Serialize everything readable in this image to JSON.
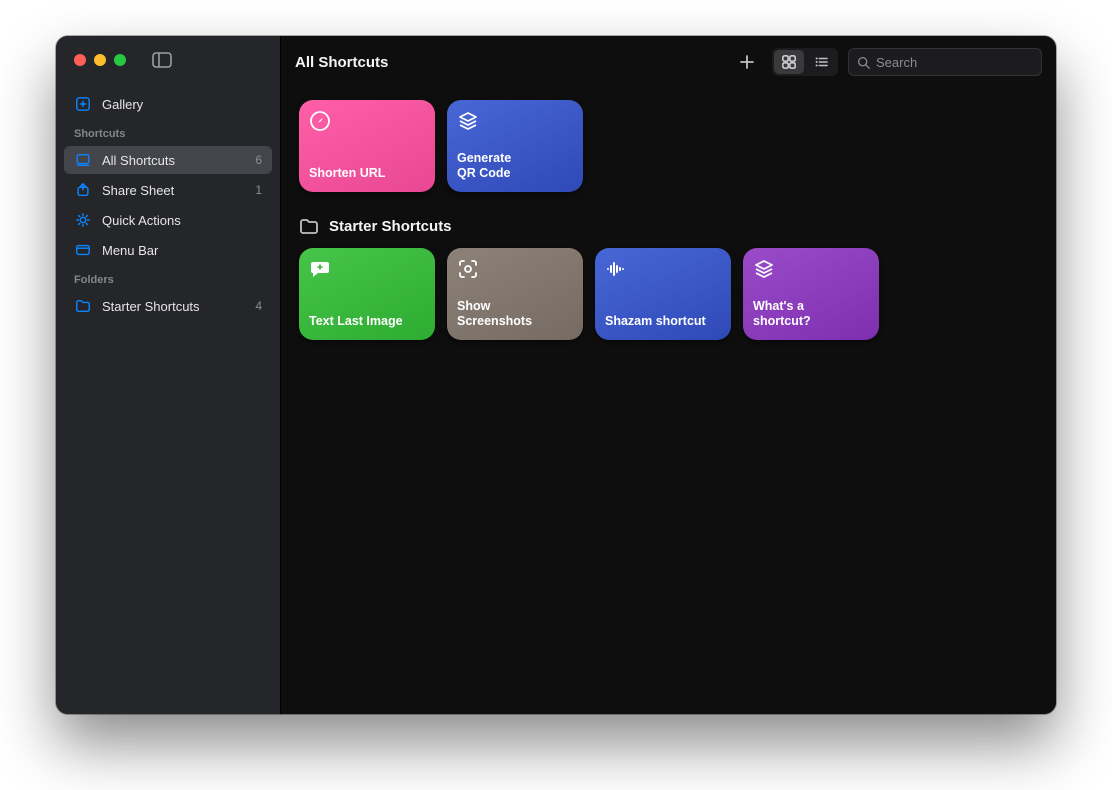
{
  "header": {
    "title": "All Shortcuts",
    "search_placeholder": "Search"
  },
  "sidebar": {
    "gallery_label": "Gallery",
    "section_shortcuts": "Shortcuts",
    "section_folders": "Folders",
    "items": [
      {
        "label": "All Shortcuts",
        "count": "6",
        "icon": "layers",
        "selected": true
      },
      {
        "label": "Share Sheet",
        "count": "1",
        "icon": "share",
        "selected": false
      },
      {
        "label": "Quick Actions",
        "count": "",
        "icon": "gear",
        "selected": false
      },
      {
        "label": "Menu Bar",
        "count": "",
        "icon": "menubar",
        "selected": false
      }
    ],
    "folders": [
      {
        "label": "Starter Shortcuts",
        "count": "4",
        "icon": "folder"
      }
    ]
  },
  "main": {
    "top_row": [
      {
        "label": "Shorten URL",
        "icon": "safari",
        "gradient": "g-pink"
      },
      {
        "label": "Generate\nQR Code",
        "icon": "layers",
        "gradient": "g-blue"
      }
    ],
    "section_title": "Starter Shortcuts",
    "starter_row": [
      {
        "label": "Text Last Image",
        "icon": "message-plus",
        "gradient": "g-green"
      },
      {
        "label": "Show\nScreenshots",
        "icon": "viewfinder",
        "gradient": "g-gray"
      },
      {
        "label": "Shazam shortcut",
        "icon": "waveform",
        "gradient": "g-blue2"
      },
      {
        "label": "What's a\nshortcut?",
        "icon": "layers",
        "gradient": "g-purple"
      }
    ]
  }
}
